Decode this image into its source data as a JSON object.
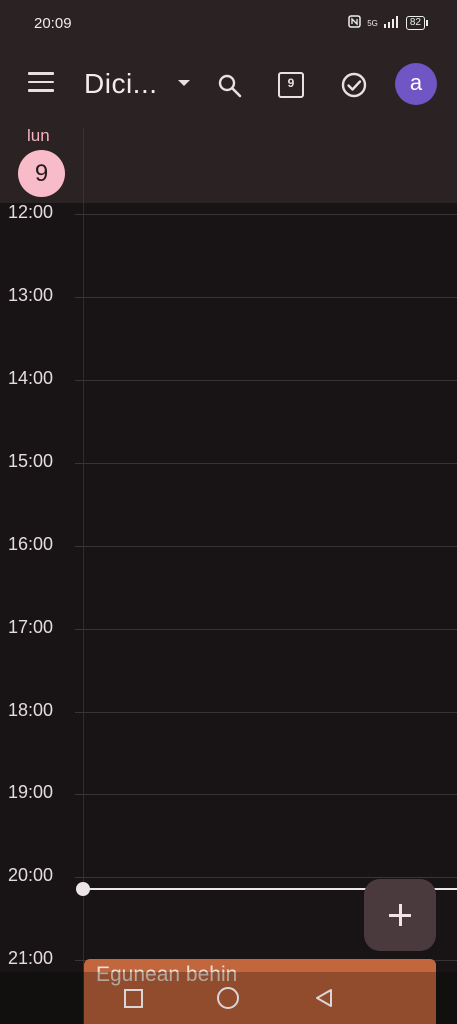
{
  "status_bar": {
    "time": "20:09",
    "network": "5G",
    "battery": "82"
  },
  "app_bar": {
    "month_title": "Dici...",
    "today_day": "9",
    "avatar_letter": "a"
  },
  "day_header": {
    "weekday": "lun",
    "day": "9"
  },
  "hours": [
    "12:00",
    "13:00",
    "14:00",
    "15:00",
    "16:00",
    "17:00",
    "18:00",
    "19:00",
    "20:00",
    "21:00"
  ],
  "event": {
    "title": "Egunean behin",
    "color": "#c2663e"
  },
  "colors": {
    "background": "#181415",
    "header": "#2a2223",
    "today_circle": "#f8bcc8",
    "avatar": "#7055c4"
  }
}
